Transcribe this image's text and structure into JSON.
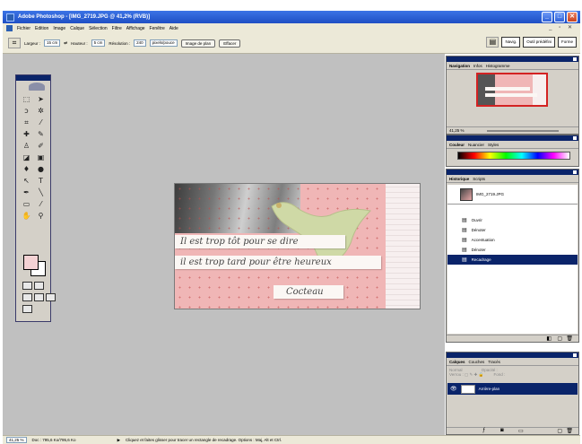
{
  "window": {
    "title": "Adobe Photoshop - [IMG_2719.JPG @ 41,2% (RVB)]",
    "minimize": "_",
    "maximize": "□",
    "close": "✕"
  },
  "menu": {
    "items": [
      "Fichier",
      "Edition",
      "Image",
      "Calque",
      "Sélection",
      "Filtre",
      "Affichage",
      "Fenêtre",
      "Aide"
    ],
    "mdi_controls": "_ ▫ ✕"
  },
  "options": {
    "width_label": "Largeur :",
    "width_value": "15 cm",
    "height_label": "Hauteur :",
    "height_value": "5 cm",
    "resolution_label": "Résolution :",
    "resolution_value": "240",
    "resolution_unit": "pixels/pouce",
    "front_image_button": "Image de plan",
    "clear_button": "Effacer",
    "file_browser": "Navig.",
    "tool_presets": "Outil prédéfini",
    "brushes": "Forme"
  },
  "document": {
    "strips": [
      "Il est trop tôt pour se dire",
      "il est trop tard pour être heureux",
      "Cocteau"
    ]
  },
  "navigator": {
    "tabs": [
      "Navigation",
      "Infos",
      "Histogramme"
    ],
    "zoom": "41,25 %"
  },
  "color_panel": {
    "tabs": [
      "Couleur",
      "Nuancier",
      "Styles"
    ]
  },
  "history": {
    "tabs": [
      "Historique",
      "Scripts"
    ],
    "snapshot": "IMG_2719.JPG",
    "items": [
      "Ouvrir",
      "Dénoter",
      "Accentuation",
      "Dénoter",
      "Recadrage"
    ],
    "active_index": 4
  },
  "layers": {
    "tabs": [
      "Calques",
      "Couches",
      "Tracés"
    ],
    "blend": "Normal",
    "opacity_label": "Opacité :",
    "lock_label": "Verrou :",
    "fill_label": "Fond :",
    "layer_name": "Arrière-plan"
  },
  "status": {
    "zoom": "41,25 %",
    "doc_size": "Doc : 795,6 Ko/795,6 Ko",
    "hint": "Cliquez et faites glisser pour tracer un rectangle de recadrage. Options : Maj, Alt et Ctrl."
  }
}
